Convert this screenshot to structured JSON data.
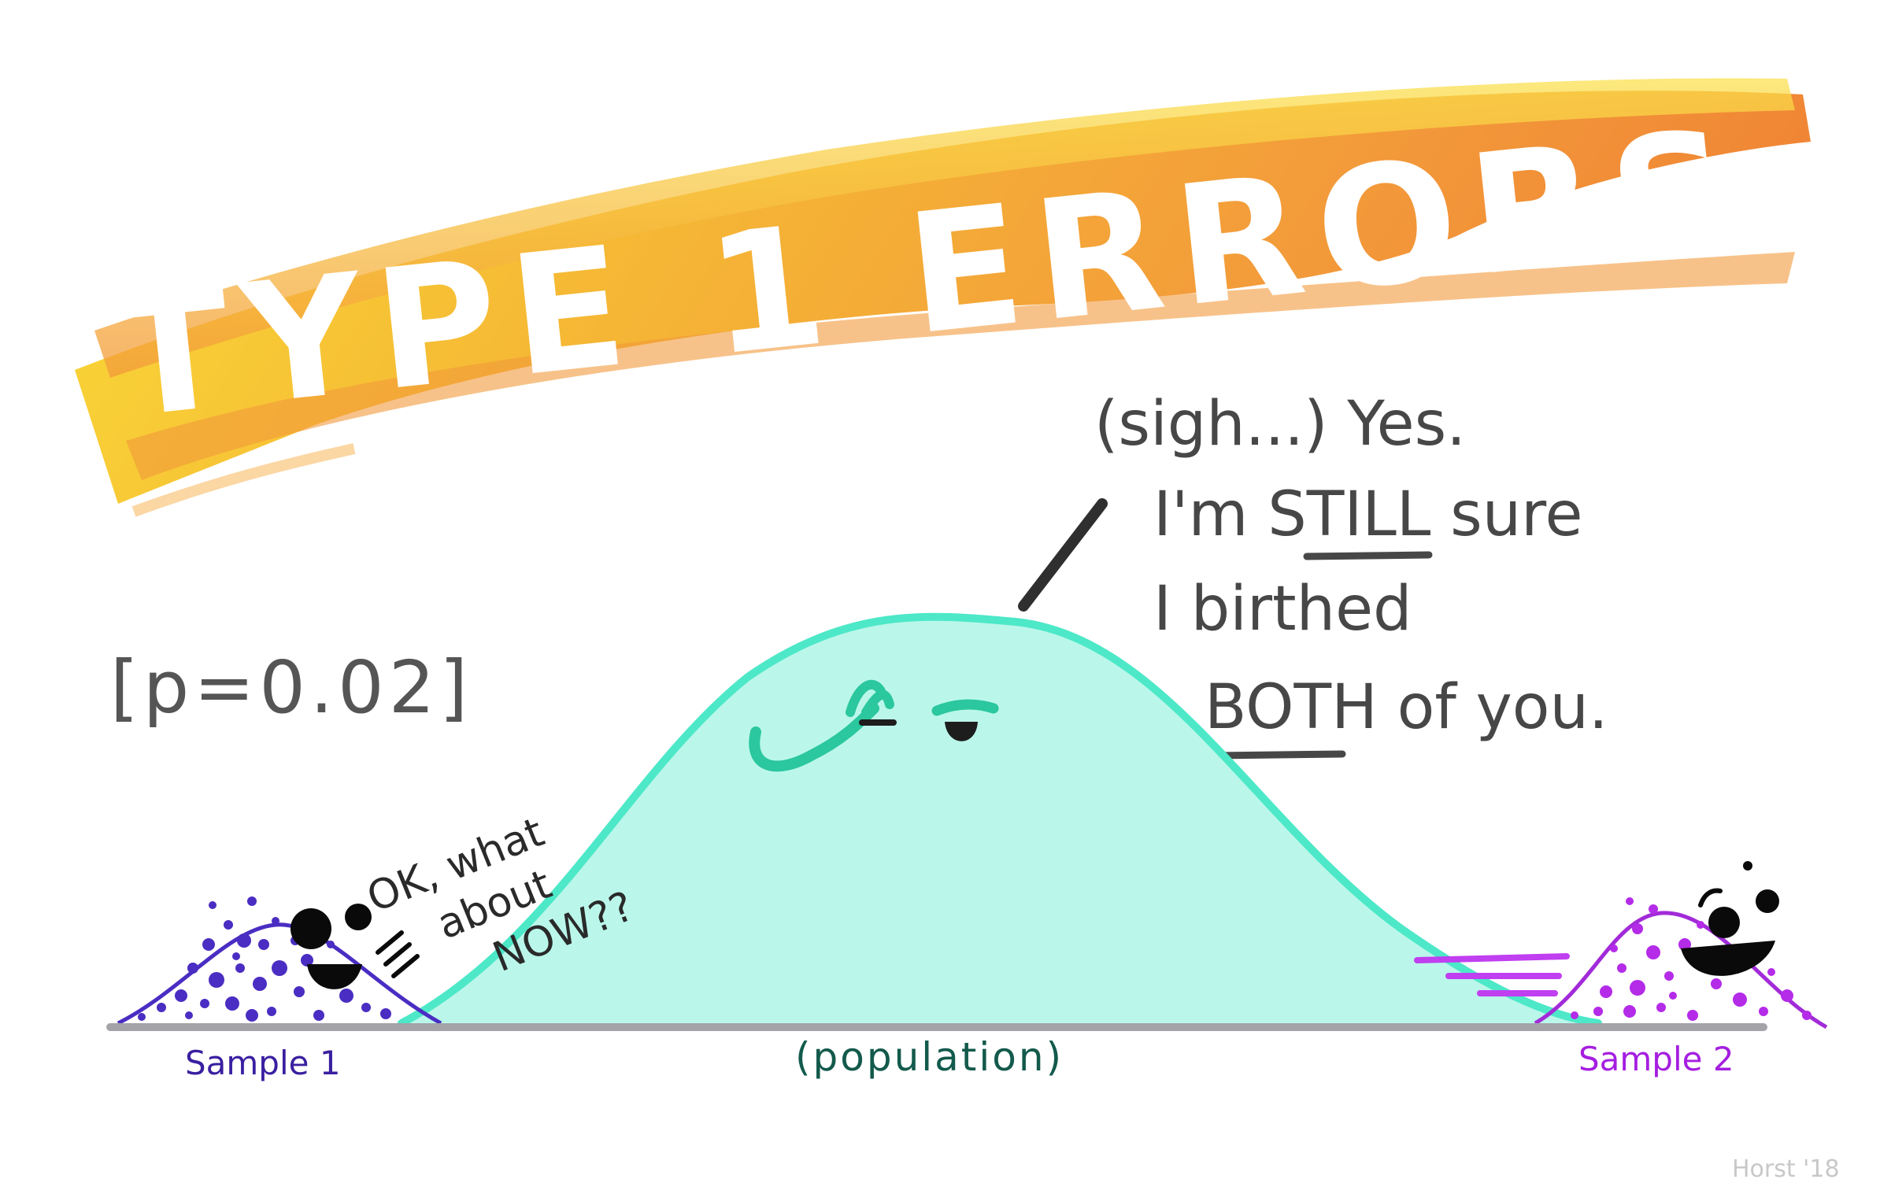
{
  "title": "TYPE 1 ERRORS",
  "p_value": "[p=0.02]",
  "population_speech": [
    "(sigh...) Yes.",
    "I'm STILL sure",
    "I birthed",
    "BOTH of you."
  ],
  "sample1_speech": [
    "OK, what",
    "about",
    "NOW??"
  ],
  "labels": {
    "sample1": "Sample 1",
    "population": "(population)",
    "sample2": "Sample 2"
  },
  "signature": "Horst '18",
  "colors": {
    "title_brush_light": "#f7d322",
    "title_brush_dark": "#f08a28",
    "population_fill": "#baf7ea",
    "population_outline": "#4de8c8",
    "sample1": "#3f22b0",
    "sample2": "#b42be8",
    "baseline": "#a3a3a8"
  }
}
